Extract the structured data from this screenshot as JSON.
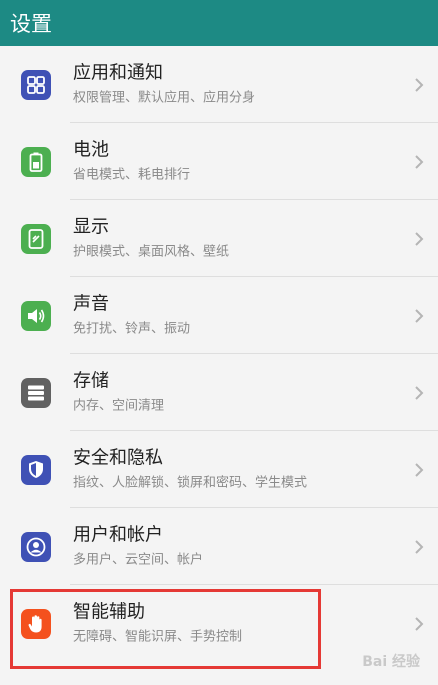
{
  "header": {
    "title": "设置"
  },
  "items": [
    {
      "title": "应用和通知",
      "subtitle": "权限管理、默认应用、应用分身",
      "icon": "apps-grid-icon",
      "color": "#3f51b5"
    },
    {
      "title": "电池",
      "subtitle": "省电模式、耗电排行",
      "icon": "battery-icon",
      "color": "#4caf50"
    },
    {
      "title": "显示",
      "subtitle": "护眼模式、桌面风格、壁纸",
      "icon": "display-icon",
      "color": "#4caf50"
    },
    {
      "title": "声音",
      "subtitle": "免打扰、铃声、振动",
      "icon": "speaker-icon",
      "color": "#4caf50"
    },
    {
      "title": "存储",
      "subtitle": "内存、空间清理",
      "icon": "storage-icon",
      "color": "#616161"
    },
    {
      "title": "安全和隐私",
      "subtitle": "指纹、人脸解锁、锁屏和密码、学生模式",
      "icon": "shield-icon",
      "color": "#3f51b5"
    },
    {
      "title": "用户和帐户",
      "subtitle": "多用户、云空间、帐户",
      "icon": "user-icon",
      "color": "#3f51b5"
    },
    {
      "title": "智能辅助",
      "subtitle": "无障碍、智能识屏、手势控制",
      "icon": "hand-icon",
      "color": "#f4511e"
    }
  ],
  "watermark": {
    "text": "Bai 经验"
  },
  "colors": {
    "header": "#1d8a84",
    "highlight": "#e53935"
  }
}
